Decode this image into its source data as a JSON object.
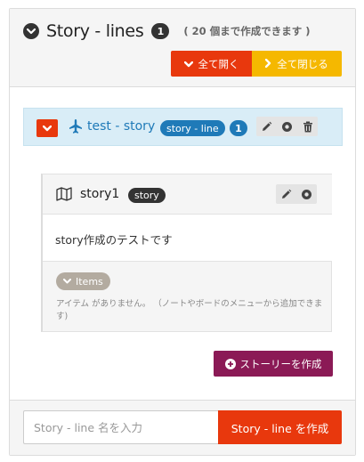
{
  "header": {
    "title": "Story - lines",
    "count": "1",
    "limit_note": "( 20 個まで作成できます )",
    "expand_all_label": "全て開く",
    "collapse_all_label": "全て閉じる"
  },
  "storyline": {
    "name": "test - story",
    "type_badge": "story - line",
    "story_count": "1"
  },
  "story": {
    "name": "story1",
    "type_badge": "story",
    "description": "story作成のテストです",
    "items_label": "Items",
    "no_items_text": "アイテム がありません。 （ノートやボードのメニューから追加できます)"
  },
  "actions": {
    "create_story_label": "ストーリーを作成"
  },
  "footer": {
    "input_value": "",
    "input_placeholder": "Story - line 名を入力",
    "create_line_label": "Story - line を作成"
  },
  "colors": {
    "red": "#e8380d",
    "yellow": "#f5b800",
    "blue": "#1f7ab8",
    "light_blue_bg": "#d9edf7",
    "purple": "#8b1a56",
    "dark": "#333333"
  },
  "icons": {
    "header_toggle": "chevron-down-circle-icon",
    "expand": "chevron-down-icon",
    "collapse": "chevron-right-icon",
    "storyline": "plane-icon",
    "story": "map-icon",
    "edit": "pencil-icon",
    "settings": "gear-icon",
    "delete": "trash-icon",
    "add": "plus-circle-icon"
  }
}
